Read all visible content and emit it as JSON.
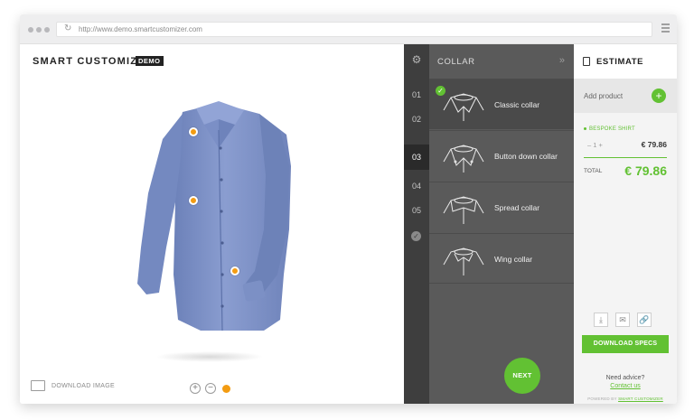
{
  "browser": {
    "url": "http://www.demo.smartcustomizer.com"
  },
  "brand": {
    "name": "SMART CUSTOMIZER",
    "badge": "DEMO"
  },
  "stage": {
    "download_image_label": "DOWNLOAD IMAGE",
    "zoom_in": "+",
    "zoom_out": "−"
  },
  "steps": {
    "items": [
      "01",
      "02",
      "03",
      "04",
      "05"
    ],
    "active": "03"
  },
  "options_panel": {
    "title": "COLLAR",
    "items": [
      {
        "label": "Classic collar",
        "selected": true
      },
      {
        "label": "Button down collar",
        "selected": false
      },
      {
        "label": "Spread collar",
        "selected": false
      },
      {
        "label": "Wing collar",
        "selected": false
      }
    ],
    "next_label": "NEXT"
  },
  "estimate": {
    "title": "ESTIMATE",
    "add_product_label": "Add product",
    "item_name": "BESPOKE SHIRT",
    "quantity": "1",
    "item_price": "€ 79.86",
    "total_label": "TOTAL",
    "total_value": "€ 79.86",
    "download_specs_label": "DOWNLOAD SPECS",
    "advice_label": "Need advice?",
    "contact_label": "Contact us",
    "powered_label": "POWERED BY",
    "powered_link": "SMART CUSTOMIZER"
  },
  "colors": {
    "accent_green": "#62c133",
    "hotspot_orange": "#f39c12",
    "shirt_blue": "#7f93c8",
    "steps_bg": "#3e3e3e",
    "options_bg": "#5a5a5a"
  }
}
